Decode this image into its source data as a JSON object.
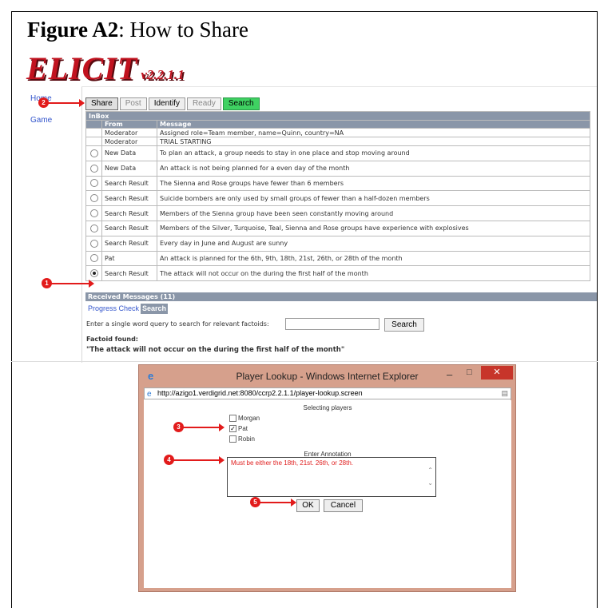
{
  "figure": {
    "label_bold": "Figure A2",
    "label_rest": ": How to Share"
  },
  "logo": {
    "name": "ELICIT",
    "version": "v2.2.1.1"
  },
  "nav": {
    "home": "Home",
    "game": "Game"
  },
  "tabs": [
    {
      "label": "Share",
      "state": "active"
    },
    {
      "label": "Post",
      "state": "disabled"
    },
    {
      "label": "Identify",
      "state": "normal"
    },
    {
      "label": "Ready",
      "state": "disabled"
    },
    {
      "label": "Search",
      "state": "highlight"
    }
  ],
  "inbox": {
    "title": "InBox",
    "columns": [
      "From",
      "Message"
    ],
    "rows": [
      {
        "radio": false,
        "selected": false,
        "from": "Moderator",
        "message": "Assigned role=Team member, name=Quinn, country=NA"
      },
      {
        "radio": false,
        "selected": false,
        "from": "Moderator",
        "message": "TRIAL STARTING"
      },
      {
        "radio": true,
        "selected": false,
        "from": "New Data",
        "message": "To plan an attack, a group needs to stay in one place and stop moving around"
      },
      {
        "radio": true,
        "selected": false,
        "from": "New Data",
        "message": "An attack is not being planned for a even day of the month"
      },
      {
        "radio": true,
        "selected": false,
        "from": "Search Result",
        "message": "The Sienna and Rose groups have fewer than 6 members"
      },
      {
        "radio": true,
        "selected": false,
        "from": "Search Result",
        "message": "Suicide bombers are only used by small groups of fewer than a half-dozen members"
      },
      {
        "radio": true,
        "selected": false,
        "from": "Search Result",
        "message": "Members of the Sienna group have been seen constantly moving around"
      },
      {
        "radio": true,
        "selected": false,
        "from": "Search Result",
        "message": "Members of the Silver, Turquoise, Teal, Sienna and Rose groups have experience with explosives"
      },
      {
        "radio": true,
        "selected": false,
        "from": "Search Result",
        "message": "Every day in June and August are sunny"
      },
      {
        "radio": true,
        "selected": false,
        "from": "Pat",
        "message": "An attack is planned for the 6th, 9th, 18th, 21st, 26th, or 28th of the month"
      },
      {
        "radio": true,
        "selected": true,
        "from": "Search Result",
        "message": "The attack will not occur on the during the first half of the month"
      }
    ]
  },
  "received": {
    "label": "Received Messages (11)"
  },
  "subtabs": {
    "progress": "Progress Check",
    "search": "Search"
  },
  "query": {
    "prompt": "Enter a single word query to search for relevant factoids:",
    "value": "",
    "button": "Search"
  },
  "factoid": {
    "label": "Factoid found:",
    "text": "\"The attack will not occur on the during the first half of the month\""
  },
  "popup": {
    "title": "Player Lookup - Windows Internet Explorer",
    "url": "http://azigo1.verdigrid.net:8080/ccrp2.2.1.1/player-lookup.screen",
    "selecting_label": "Selecting players",
    "players": [
      {
        "name": "Morgan",
        "checked": false
      },
      {
        "name": "Pat",
        "checked": true
      },
      {
        "name": "Robin",
        "checked": false
      }
    ],
    "annotation_label": "Enter Annotation",
    "annotation_value": "Must be either the 18th, 21st. 26th, or 28th.",
    "ok": "OK",
    "cancel": "Cancel"
  },
  "markers": [
    "1",
    "2",
    "3",
    "4",
    "5"
  ],
  "colors": {
    "marker": "#e21b1b",
    "search_tab": "#3fd162",
    "header_bg": "#8a96a8",
    "logo": "#c1121f",
    "ie_frame": "#d6a08c"
  }
}
